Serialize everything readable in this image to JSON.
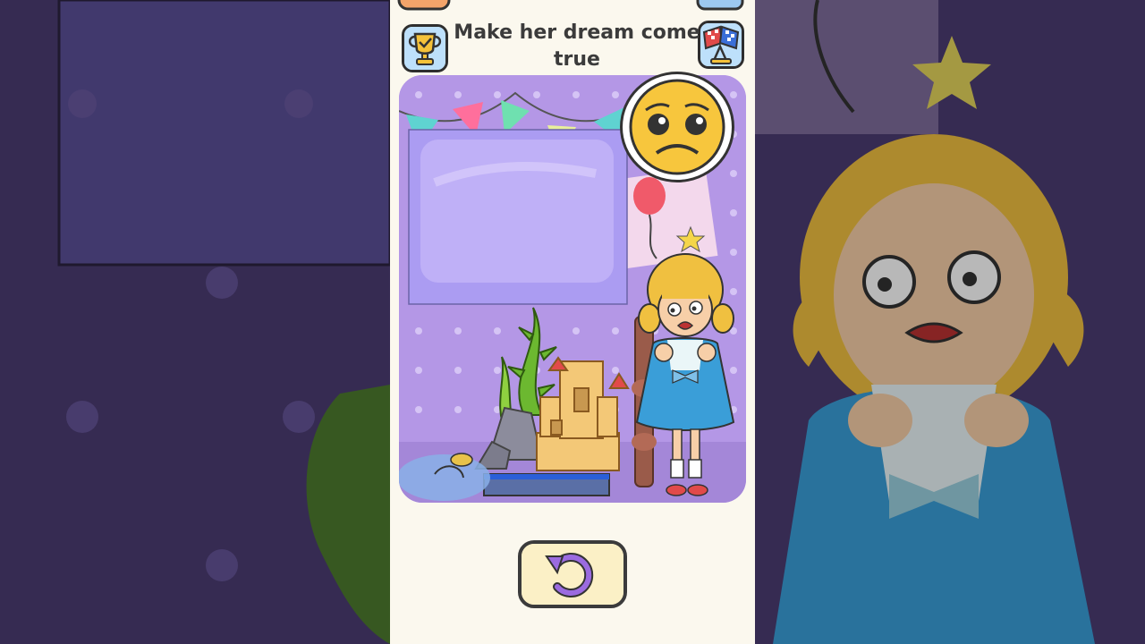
{
  "level": {
    "title": "Make her dream come true"
  },
  "header": {
    "left_icon": "trophy-icon",
    "right_icon": "checkered-flag-icon"
  },
  "scene": {
    "mood_icon": "pleading-face-icon",
    "bunting_colors": [
      "#5fd3d1",
      "#ff6f9c",
      "#6fe0b0",
      "#e8ef9c",
      "#5fd3d1"
    ],
    "items": [
      "photo-frame",
      "balloon-poster",
      "seaweed",
      "rock",
      "sand-castle",
      "shell",
      "girl",
      "chair"
    ]
  },
  "controls": {
    "undo_icon": "undo-arrow-icon"
  },
  "colors": {
    "phone_bg": "#fbf8ee",
    "room_wall": "#b79be8",
    "undo_bg": "#fbf0c6",
    "undo_arrow": "#9b6be0"
  }
}
